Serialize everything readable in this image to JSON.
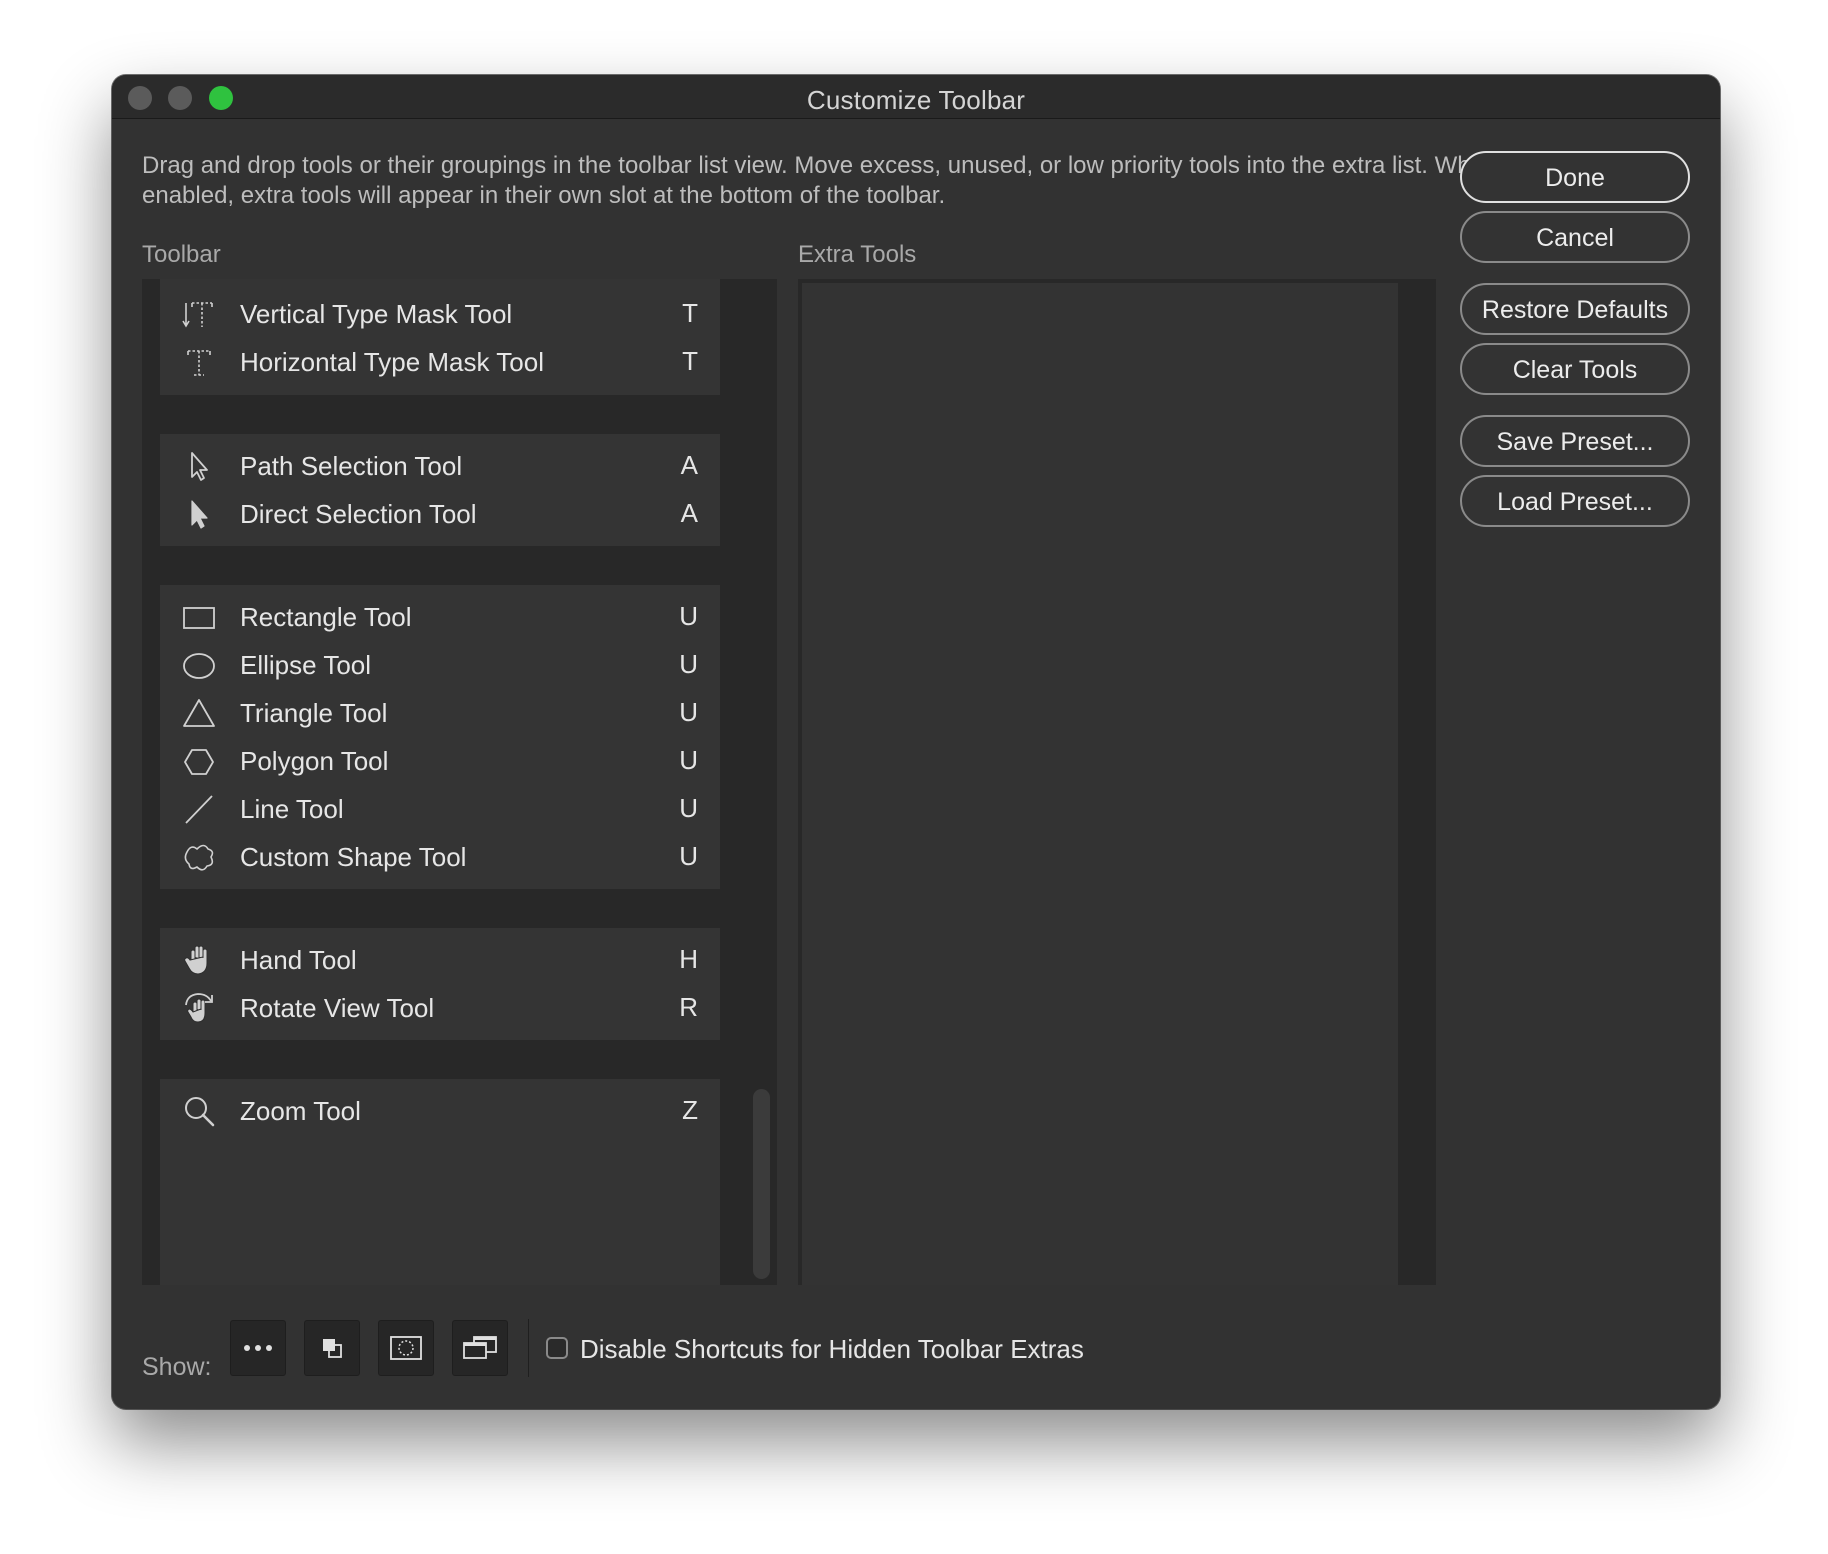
{
  "window": {
    "title": "Customize Toolbar"
  },
  "description": "Drag and drop tools or their groupings in the toolbar list view. Move excess, unused, or low priority tools into the extra list. When enabled, extra tools will appear in their own slot at the bottom of the toolbar.",
  "toolbar": {
    "label": "Toolbar",
    "groups": [
      {
        "tools": [
          {
            "name": "Vertical Type Mask Tool",
            "key": "T",
            "icon": "vertical-type-mask-icon"
          },
          {
            "name": "Horizontal Type Mask Tool",
            "key": "T",
            "icon": "horizontal-type-mask-icon"
          }
        ]
      },
      {
        "tools": [
          {
            "name": "Path Selection Tool",
            "key": "A",
            "icon": "path-selection-icon"
          },
          {
            "name": "Direct Selection Tool",
            "key": "A",
            "icon": "direct-selection-icon"
          }
        ]
      },
      {
        "tools": [
          {
            "name": "Rectangle Tool",
            "key": "U",
            "icon": "rectangle-icon"
          },
          {
            "name": "Ellipse Tool",
            "key": "U",
            "icon": "ellipse-icon"
          },
          {
            "name": "Triangle Tool",
            "key": "U",
            "icon": "triangle-icon"
          },
          {
            "name": "Polygon Tool",
            "key": "U",
            "icon": "polygon-icon"
          },
          {
            "name": "Line Tool",
            "key": "U",
            "icon": "line-icon"
          },
          {
            "name": "Custom Shape Tool",
            "key": "U",
            "icon": "custom-shape-icon"
          }
        ]
      },
      {
        "tools": [
          {
            "name": "Hand Tool",
            "key": "H",
            "icon": "hand-icon"
          },
          {
            "name": "Rotate View Tool",
            "key": "R",
            "icon": "rotate-view-icon"
          }
        ]
      },
      {
        "tools": [
          {
            "name": "Zoom Tool",
            "key": "Z",
            "icon": "zoom-icon"
          }
        ]
      }
    ]
  },
  "extra": {
    "label": "Extra Tools"
  },
  "buttons": {
    "done": "Done",
    "cancel": "Cancel",
    "restore_defaults": "Restore Defaults",
    "clear_tools": "Clear Tools",
    "save_preset": "Save Preset...",
    "load_preset": "Load Preset..."
  },
  "footer": {
    "show_label": "Show:",
    "show_buttons": [
      "more-options-icon",
      "foreground-background-icon",
      "quick-mask-icon",
      "screen-mode-icon"
    ],
    "checkbox_label": "Disable Shortcuts for Hidden Toolbar Extras",
    "checkbox_checked": false
  },
  "colors": {
    "window_bg": "#323232",
    "close_dot": "#5b5b5b",
    "minimize_dot": "#5b5b5b",
    "zoom_dot": "#2fc23f"
  }
}
